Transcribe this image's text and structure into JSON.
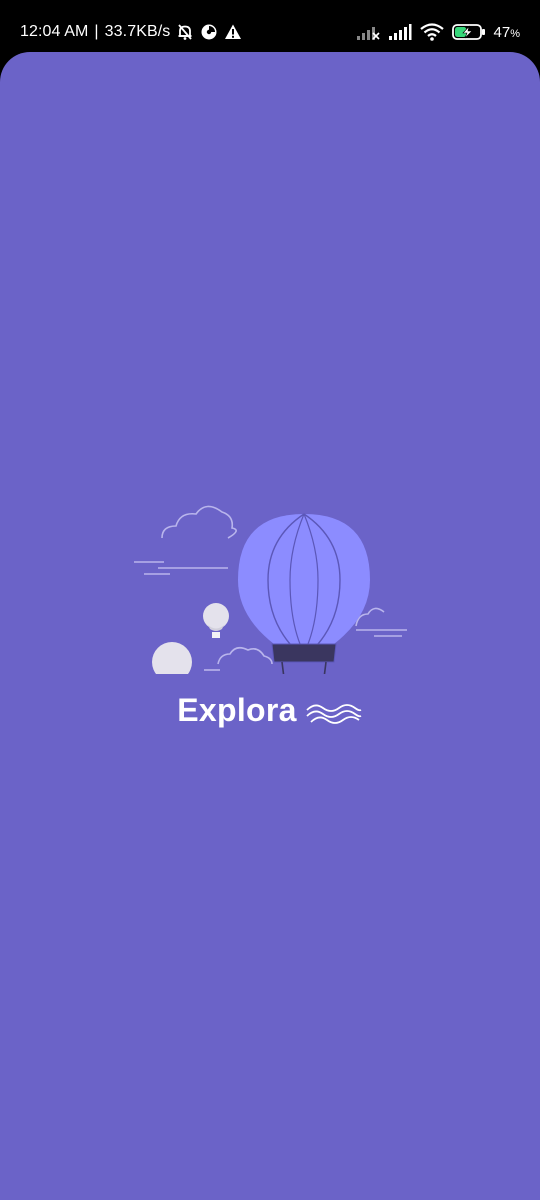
{
  "status_bar": {
    "time": "12:04 AM",
    "separator": "|",
    "net_speed": "33.7KB/s",
    "battery_percent": "47",
    "battery_unit": "%",
    "battery_level": 0.47,
    "icons": [
      "mute-bell-icon",
      "data-saver-icon",
      "warning-icon",
      "signal-no-service-icon",
      "signal-icon",
      "wifi-icon",
      "battery-charging-icon"
    ]
  },
  "splash": {
    "background_color": "#6b63c8",
    "accent_color": "#8c8cff",
    "brand_name": "Explora",
    "icons": [
      "hot-air-balloon-icon",
      "small-balloon-icon",
      "cloud-icon",
      "waves-logo-icon"
    ]
  }
}
